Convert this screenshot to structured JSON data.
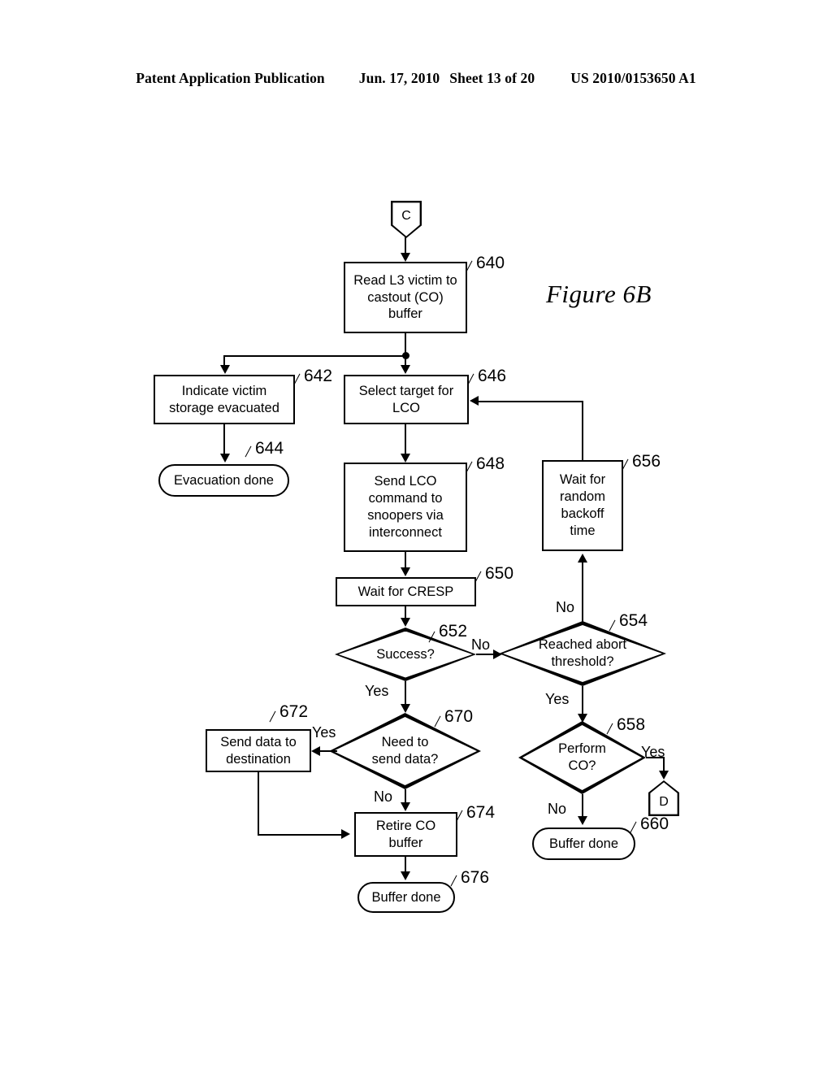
{
  "header": {
    "publication": "Patent Application Publication",
    "date": "Jun. 17, 2010",
    "sheet": "Sheet 13 of 20",
    "patent_number": "US 2010/0153650 A1"
  },
  "figure": {
    "caption": "Figure 6B"
  },
  "flowchart": {
    "nodes": [
      {
        "id": "C",
        "ref": "",
        "type": "connector-down",
        "label": "C"
      },
      {
        "id": "640",
        "ref": "640",
        "type": "process",
        "label": "Read L3 victim to castout (CO) buffer"
      },
      {
        "id": "642",
        "ref": "642",
        "type": "process",
        "label": "Indicate victim storage evacuated"
      },
      {
        "id": "644",
        "ref": "644",
        "type": "terminal",
        "label": "Evacuation done"
      },
      {
        "id": "646",
        "ref": "646",
        "type": "process",
        "label": "Select target for LCO"
      },
      {
        "id": "648",
        "ref": "648",
        "type": "process",
        "label": "Send LCO command to snoopers via interconnect"
      },
      {
        "id": "650",
        "ref": "650",
        "type": "process",
        "label": "Wait for CRESP"
      },
      {
        "id": "652",
        "ref": "652",
        "type": "decision",
        "label": "Success?"
      },
      {
        "id": "654",
        "ref": "654",
        "type": "decision",
        "label": "Reached abort threshold?"
      },
      {
        "id": "656",
        "ref": "656",
        "type": "process",
        "label": "Wait for random backoff time"
      },
      {
        "id": "658",
        "ref": "658",
        "type": "decision",
        "label": "Perform CO?"
      },
      {
        "id": "660",
        "ref": "660",
        "type": "terminal",
        "label": "Buffer done"
      },
      {
        "id": "D",
        "ref": "",
        "type": "connector-up",
        "label": "D"
      },
      {
        "id": "670",
        "ref": "670",
        "type": "decision",
        "label": "Need to send data?"
      },
      {
        "id": "672",
        "ref": "672",
        "type": "process",
        "label": "Send data to destination"
      },
      {
        "id": "674",
        "ref": "674",
        "type": "process",
        "label": "Retire CO buffer"
      },
      {
        "id": "676",
        "ref": "676",
        "type": "terminal",
        "label": "Buffer done"
      }
    ],
    "node_text": {
      "c_connector": "C",
      "d_connector": "D",
      "n640_l1": "Read L3 victim to",
      "n640_l2": "castout (CO)",
      "n640_l3": "buffer",
      "n642_l1": "Indicate victim",
      "n642_l2": "storage evacuated",
      "n644": "Evacuation done",
      "n646_l1": "Select target for",
      "n646_l2": "LCO",
      "n648_l1": "Send LCO",
      "n648_l2": "command to",
      "n648_l3": "snoopers via",
      "n648_l4": "interconnect",
      "n650": "Wait for CRESP",
      "n652": "Success?",
      "n654_l1": "Reached abort",
      "n654_l2": "threshold?",
      "n656_l1": "Wait for",
      "n656_l2": "random",
      "n656_l3": "backoff",
      "n656_l4": "time",
      "n658_l1": "Perform",
      "n658_l2": "CO?",
      "n660": "Buffer done",
      "n670_l1": "Need to",
      "n670_l2": "send data?",
      "n672_l1": "Send data to",
      "n672_l2": "destination",
      "n674_l1": "Retire CO",
      "n674_l2": "buffer",
      "n676": "Buffer done"
    },
    "refs": {
      "r640": "640",
      "r642": "642",
      "r644": "644",
      "r646": "646",
      "r648": "648",
      "r650": "650",
      "r652": "652",
      "r654": "654",
      "r656": "656",
      "r658": "658",
      "r660": "660",
      "r670": "670",
      "r672": "672",
      "r674": "674",
      "r676": "676"
    },
    "branch_labels": {
      "b652_no": "No",
      "b652_yes": "Yes",
      "b654_no": "No",
      "b654_yes": "Yes",
      "b658_yes": "Yes",
      "b658_no": "No",
      "b670_yes": "Yes",
      "b670_no": "No"
    },
    "edges": [
      {
        "from": "C",
        "to": "640",
        "label": ""
      },
      {
        "from": "640",
        "to": "646",
        "label": ""
      },
      {
        "from": "640",
        "to": "642",
        "label": ""
      },
      {
        "from": "642",
        "to": "644",
        "label": ""
      },
      {
        "from": "646",
        "to": "648",
        "label": ""
      },
      {
        "from": "648",
        "to": "650",
        "label": ""
      },
      {
        "from": "650",
        "to": "652",
        "label": ""
      },
      {
        "from": "652",
        "to": "654",
        "label": "No"
      },
      {
        "from": "652",
        "to": "670",
        "label": "Yes"
      },
      {
        "from": "654",
        "to": "656",
        "label": "No"
      },
      {
        "from": "654",
        "to": "658",
        "label": "Yes"
      },
      {
        "from": "656",
        "to": "646",
        "label": ""
      },
      {
        "from": "658",
        "to": "D",
        "label": "Yes"
      },
      {
        "from": "658",
        "to": "660",
        "label": "No"
      },
      {
        "from": "670",
        "to": "672",
        "label": "Yes"
      },
      {
        "from": "670",
        "to": "674",
        "label": "No"
      },
      {
        "from": "672",
        "to": "674",
        "label": ""
      },
      {
        "from": "674",
        "to": "676",
        "label": ""
      }
    ]
  },
  "colors": {
    "ink": "#000000",
    "paper": "#ffffff"
  }
}
